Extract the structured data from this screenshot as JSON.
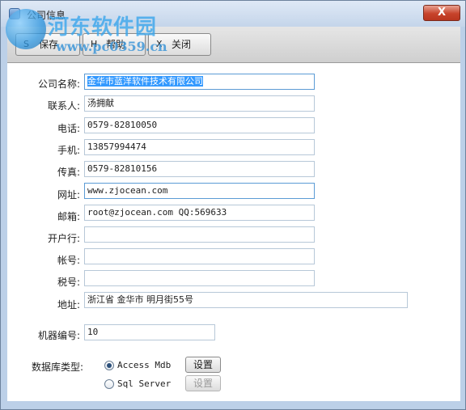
{
  "window": {
    "title": "公司信息",
    "close_label": "X"
  },
  "watermark": {
    "name": "河东软件园",
    "url": "www.pc0359.cn"
  },
  "toolbar": {
    "save": {
      "icon": "S",
      "label": "保存"
    },
    "help": {
      "icon": "H",
      "label": "帮助"
    },
    "close": {
      "icon": "X",
      "label": "关闭"
    }
  },
  "form": {
    "company": {
      "label": "公司名称:",
      "value": "金华市蓝洋软件技术有限公司"
    },
    "contact": {
      "label": "联系人:",
      "value": "汤拥献"
    },
    "phone": {
      "label": "电话:",
      "value": "0579-82810050"
    },
    "mobile": {
      "label": "手机:",
      "value": "13857994474"
    },
    "fax": {
      "label": "传真:",
      "value": "0579-82810156"
    },
    "website": {
      "label": "网址:",
      "value": "www.zjocean.com"
    },
    "email": {
      "label": "邮箱:",
      "value": "root@zjocean.com  QQ:569633"
    },
    "bank": {
      "label": "开户行:",
      "value": ""
    },
    "account": {
      "label": "帐号:",
      "value": ""
    },
    "tax": {
      "label": "税号:",
      "value": ""
    },
    "address": {
      "label": "地址:",
      "value": "浙江省 金华市 明月街55号"
    },
    "machine_no": {
      "label": "机器编号:",
      "value": "10"
    }
  },
  "database": {
    "label": "数据库类型:",
    "options": [
      {
        "label": "Access Mdb",
        "selected": true,
        "settings": "设置",
        "settings_enabled": true
      },
      {
        "label": "Sql Server",
        "selected": false,
        "settings": "设置",
        "settings_enabled": false
      }
    ]
  }
}
